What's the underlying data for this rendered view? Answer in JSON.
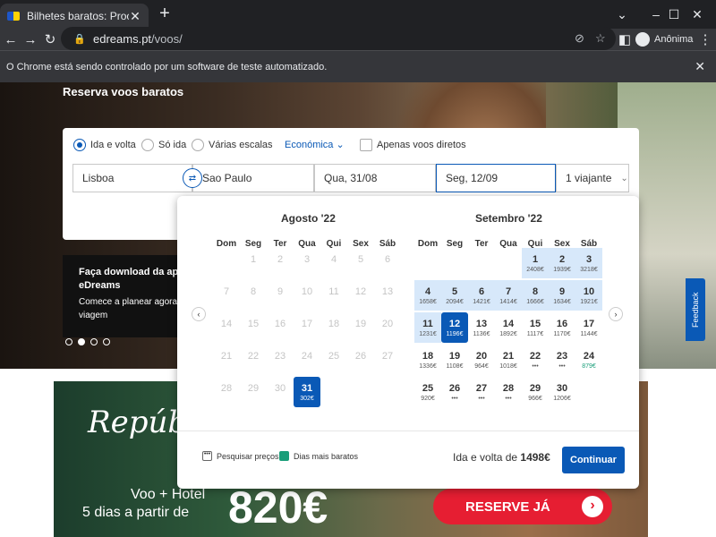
{
  "browser": {
    "tab_title": "Bilhetes baratos: Procura e reserv",
    "url_host": "edreams.pt",
    "url_path": "/voos/",
    "profile": "Anônima",
    "infobar": "O Chrome está sendo controlado por um software de teste automatizado."
  },
  "hero": {
    "title": "Reserva voos baratos"
  },
  "search": {
    "trip_types": [
      "Ida e volta",
      "Só ida",
      "Várias escalas"
    ],
    "cabin": "Económica",
    "direct_only": "Apenas voos diretos",
    "origin": "Lisboa",
    "destination": "Sao Paulo",
    "depart": "Qua, 31/08",
    "return": "Seg, 12/09",
    "travellers": "1 viajante"
  },
  "promo": {
    "title": "Faça download da ap eDreams",
    "subtitle": "Comece a planear agora viagem"
  },
  "calendar": {
    "weekdays": [
      "Dom",
      "Seg",
      "Ter",
      "Qua",
      "Qui",
      "Sex",
      "Sáb"
    ],
    "months": [
      {
        "title": "Agosto '22",
        "days": [
          {
            "d": "1",
            "p": "",
            "s": "dis"
          },
          {
            "d": "2",
            "p": "",
            "s": "dis"
          },
          {
            "d": "3",
            "p": "",
            "s": "dis"
          },
          {
            "d": "4",
            "p": "",
            "s": "dis"
          },
          {
            "d": "5",
            "p": "",
            "s": "dis"
          },
          {
            "d": "6",
            "p": "",
            "s": "dis"
          },
          {
            "d": "7",
            "p": "",
            "s": "dis"
          },
          {
            "d": "8",
            "p": "",
            "s": "dis"
          },
          {
            "d": "9",
            "p": "",
            "s": "dis"
          },
          {
            "d": "10",
            "p": "",
            "s": "dis"
          },
          {
            "d": "11",
            "p": "",
            "s": "dis"
          },
          {
            "d": "12",
            "p": "",
            "s": "dis"
          },
          {
            "d": "13",
            "p": "",
            "s": "dis"
          },
          {
            "d": "14",
            "p": "",
            "s": "dis"
          },
          {
            "d": "15",
            "p": "",
            "s": "dis"
          },
          {
            "d": "16",
            "p": "",
            "s": "dis"
          },
          {
            "d": "17",
            "p": "",
            "s": "dis"
          },
          {
            "d": "18",
            "p": "",
            "s": "dis"
          },
          {
            "d": "19",
            "p": "",
            "s": "dis"
          },
          {
            "d": "20",
            "p": "",
            "s": "dis"
          },
          {
            "d": "21",
            "p": "",
            "s": "dis"
          },
          {
            "d": "22",
            "p": "",
            "s": "dis"
          },
          {
            "d": "23",
            "p": "",
            "s": "dis"
          },
          {
            "d": "24",
            "p": "",
            "s": "dis"
          },
          {
            "d": "25",
            "p": "",
            "s": "dis"
          },
          {
            "d": "26",
            "p": "",
            "s": "dis"
          },
          {
            "d": "27",
            "p": "",
            "s": "dis"
          },
          {
            "d": "28",
            "p": "",
            "s": "dis"
          },
          {
            "d": "29",
            "p": "",
            "s": "dis"
          },
          {
            "d": "30",
            "p": "",
            "s": "dis"
          },
          {
            "d": "31",
            "p": "302€",
            "s": "sel"
          }
        ]
      },
      {
        "title": "Setembro '22",
        "days": [
          {
            "d": "1",
            "p": "2408€",
            "s": "hl"
          },
          {
            "d": "2",
            "p": "1939€",
            "s": "hl"
          },
          {
            "d": "3",
            "p": "3218€",
            "s": "hl"
          },
          {
            "d": "4",
            "p": "1658€",
            "s": "hl"
          },
          {
            "d": "5",
            "p": "2094€",
            "s": "hl"
          },
          {
            "d": "6",
            "p": "1421€",
            "s": "hl"
          },
          {
            "d": "7",
            "p": "1414€",
            "s": "hl"
          },
          {
            "d": "8",
            "p": "1666€",
            "s": "hl"
          },
          {
            "d": "9",
            "p": "1634€",
            "s": "hl"
          },
          {
            "d": "10",
            "p": "1921€",
            "s": "hl"
          },
          {
            "d": "11",
            "p": "1231€",
            "s": "hl"
          },
          {
            "d": "12",
            "p": "1196€",
            "s": "sel"
          },
          {
            "d": "13",
            "p": "1136€",
            "s": ""
          },
          {
            "d": "14",
            "p": "1892€",
            "s": ""
          },
          {
            "d": "15",
            "p": "1117€",
            "s": ""
          },
          {
            "d": "16",
            "p": "1170€",
            "s": ""
          },
          {
            "d": "17",
            "p": "1144€",
            "s": ""
          },
          {
            "d": "18",
            "p": "1336€",
            "s": ""
          },
          {
            "d": "19",
            "p": "1108€",
            "s": ""
          },
          {
            "d": "20",
            "p": "964€",
            "s": ""
          },
          {
            "d": "21",
            "p": "1018€",
            "s": ""
          },
          {
            "d": "22",
            "p": "•••",
            "s": ""
          },
          {
            "d": "23",
            "p": "•••",
            "s": ""
          },
          {
            "d": "24",
            "p": "879€",
            "s": "green"
          },
          {
            "d": "25",
            "p": "920€",
            "s": ""
          },
          {
            "d": "26",
            "p": "•••",
            "s": ""
          },
          {
            "d": "27",
            "p": "•••",
            "s": ""
          },
          {
            "d": "28",
            "p": "•••",
            "s": ""
          },
          {
            "d": "29",
            "p": "966€",
            "s": ""
          },
          {
            "d": "30",
            "p": "1206€",
            "s": ""
          }
        ]
      }
    ],
    "legend_search": "Pesquisar preços",
    "legend_cheapest": "Dias mais baratos",
    "total_label": "Ida e volta de",
    "total_value": "1498€",
    "continue": "Continuar"
  },
  "banner": {
    "title": "Repúbl",
    "line1": "Voo + Hotel",
    "line2": "5 dias a partir de",
    "price": "820€",
    "cta": "RESERVE JÁ"
  },
  "feedback": "Feedback",
  "colors": {
    "brand": "#0a59b6",
    "cheap": "#1a9e79",
    "cta": "#e61e32"
  }
}
